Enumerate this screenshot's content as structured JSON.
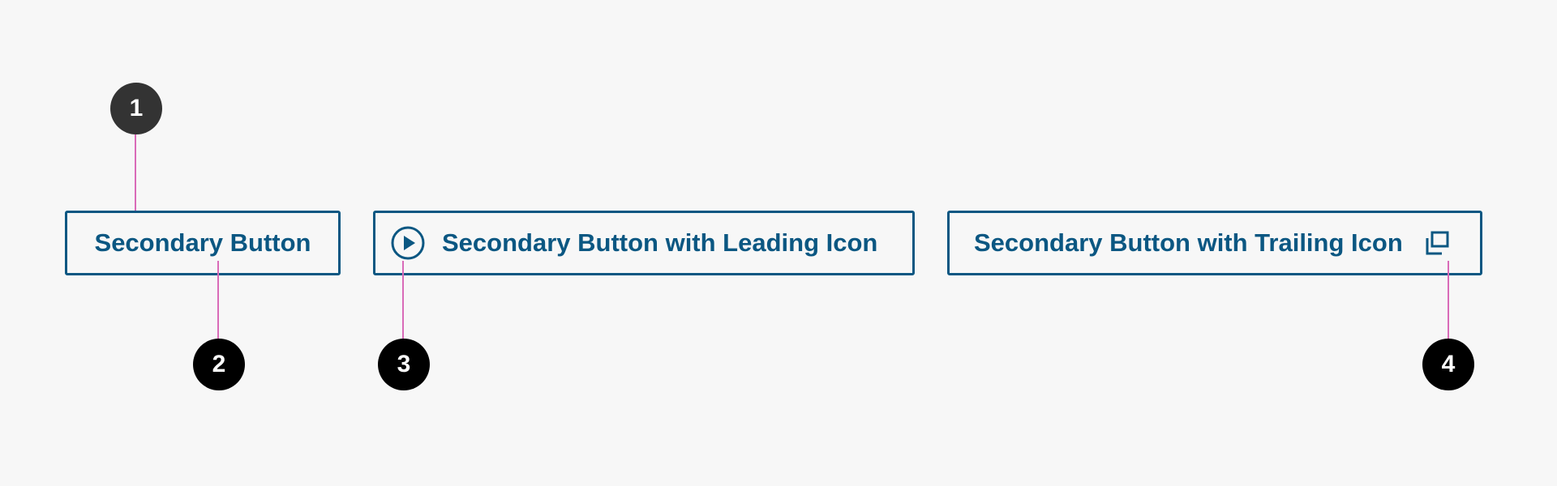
{
  "buttons": {
    "secondary": {
      "label": "Secondary Button"
    },
    "leading_icon": {
      "label": "Secondary Button with Leading Icon",
      "icon": "play-circle-icon"
    },
    "trailing_icon": {
      "label": "Secondary Button with Trailing Icon",
      "icon": "launch-icon"
    }
  },
  "callouts": {
    "c1": "1",
    "c2": "2",
    "c3": "3",
    "c4": "4"
  },
  "colors": {
    "button": "#0b5782",
    "background": "#f7f7f7",
    "leader_line": "#d96bb8",
    "callout_1": "#333333",
    "callout_other": "#000000"
  }
}
